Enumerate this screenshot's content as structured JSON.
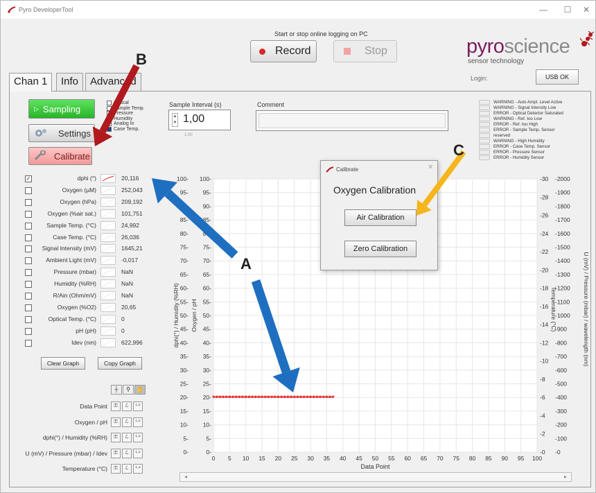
{
  "window": {
    "title": "Pyro DeveloperTool",
    "controls": [
      "—",
      "☐",
      "✕"
    ]
  },
  "header": {
    "logging_label": "Start or stop online logging on PC",
    "record_label": "Record",
    "stop_label": "Stop",
    "logo_part1": "pyro",
    "logo_part2": "science",
    "logo_sub": "sensor technology",
    "login_label": "Login:",
    "usb_label": "USB OK"
  },
  "tabs": [
    {
      "label": "Chan 1"
    },
    {
      "label": "Info"
    },
    {
      "label": "Advanced"
    }
  ],
  "controls": {
    "sampling_label": "Sampling",
    "settings_label": "Settings",
    "calibrate_label": "Calibrate",
    "options": [
      {
        "label": "Optical",
        "checked": false
      },
      {
        "label": "Sample Temp.",
        "checked": false
      },
      {
        "label": "Pressure",
        "checked": false
      },
      {
        "label": "Humidity",
        "checked": false
      },
      {
        "label": "Analog In",
        "checked": false
      },
      {
        "label": "Case Temp.",
        "checked": true
      }
    ],
    "interval_label": "Sample Interval (s)",
    "interval_value": "1,00",
    "interval_note": "1.00",
    "comment_label": "Comment",
    "comment_value": ""
  },
  "warnings": [
    "WARNING - Auto Ampl. Level Active",
    "WARNING - Signal Intensity Low",
    "ERROR - Optical Detector Saturated",
    "WARNING - Ref. too Low",
    "ERROR - Ref. too High",
    "ERROR - Sample Temp. Sensor",
    "reserved",
    "WARNING - High Humidity",
    "ERROR - Case Temp. Sensor",
    "ERROR - Pressure Sensor",
    "ERROR - Humidity Sensor"
  ],
  "channels": [
    {
      "name": "dphi (°)",
      "value": "20,116",
      "checked": true
    },
    {
      "name": "Oxygen (µM)",
      "value": "252,043",
      "checked": false
    },
    {
      "name": "Oxygen (hPa)",
      "value": "209,192",
      "checked": false
    },
    {
      "name": "Oxygen (%air sat.)",
      "value": "101,751",
      "checked": false
    },
    {
      "name": "Sample Temp. (°C)",
      "value": "24,992",
      "checked": false
    },
    {
      "name": "Case Temp. (°C)",
      "value": "26,036",
      "checked": false
    },
    {
      "name": "Signal Intensity (mV)",
      "value": "1645,21",
      "checked": false
    },
    {
      "name": "Ambient Light (mV)",
      "value": "-0,017",
      "checked": false
    },
    {
      "name": "Pressure (mbar)",
      "value": "NaN",
      "checked": false
    },
    {
      "name": "Humidity (%RH)",
      "value": "NaN",
      "checked": false
    },
    {
      "name": "R/Ain (Ohm/mV)",
      "value": "NaN",
      "checked": false
    },
    {
      "name": "Oxygen (%O2)",
      "value": "20,65",
      "checked": false
    },
    {
      "name": "Optical Temp. (°C)",
      "value": "0",
      "checked": false
    },
    {
      "name": "pH (pH)",
      "value": "0",
      "checked": false
    },
    {
      "name": "Idev (nm)",
      "value": "622,996",
      "checked": false
    }
  ],
  "graph_buttons": {
    "clear_label": "Clear Graph",
    "copy_label": "Copy Graph"
  },
  "axis_controls": [
    {
      "label": "Data Point"
    },
    {
      "label": "Oxygen / pH"
    },
    {
      "label": "dphi(°) / Humidity (%RH)"
    },
    {
      "label": "U (mV) / Pressure (mbar) / Idev"
    },
    {
      "label": "Temperature (°C)"
    }
  ],
  "dialog": {
    "title": "Calibrate",
    "close": "✕",
    "heading": "Oxygen Calibration",
    "air_label": "Air Calibration",
    "zero_label": "Zero Calibration"
  },
  "annotations": {
    "a": "A",
    "b": "B",
    "c": "C"
  },
  "colors": {
    "arrow_a": "#1f6fc0",
    "arrow_b": "#b0191e",
    "arrow_c": "#f5b51b",
    "series": "#e02828",
    "logo_brand": "#7a1f5c"
  },
  "chart_data": {
    "type": "line",
    "xlabel": "Data Point",
    "ylabel_left_outer": "dphi(°) / Humidity (%RH)",
    "ylabel_left_inner": "Oxygen / pH",
    "ylabel_right_inner": "Temperature (°C)",
    "ylabel_right_outer": "U (mV) / Pressure (mbar) / wavelength (nm)",
    "xlim": [
      0,
      100
    ],
    "ylim_left": [
      0,
      100
    ],
    "ylim_right_inner": [
      0,
      30
    ],
    "ylim_right_outer": [
      0,
      2000
    ],
    "x_ticks": [
      0,
      5,
      10,
      15,
      20,
      25,
      30,
      35,
      40,
      45,
      50,
      55,
      60,
      65,
      70,
      75,
      80,
      85,
      90,
      95,
      100
    ],
    "y_ticks_left": [
      0,
      5,
      10,
      15,
      20,
      25,
      30,
      35,
      40,
      45,
      50,
      55,
      60,
      65,
      70,
      75,
      80,
      85,
      90,
      95,
      100
    ],
    "y_ticks_right_inner": [
      0,
      2,
      4,
      6,
      8,
      10,
      12,
      14,
      16,
      18,
      20,
      22,
      24,
      26,
      28,
      30
    ],
    "y_ticks_right_outer": [
      0,
      -100,
      -200,
      -300,
      -400,
      -500,
      -600,
      -700,
      -800,
      -900,
      -1000,
      -1100,
      -1200,
      -1300,
      -1400,
      -1500,
      -1600,
      -1700,
      -1800,
      -1900,
      -2000
    ],
    "grid": true,
    "series": [
      {
        "name": "dphi (°)",
        "x_start": 0,
        "x_end": 37,
        "y": 20.1
      }
    ]
  }
}
